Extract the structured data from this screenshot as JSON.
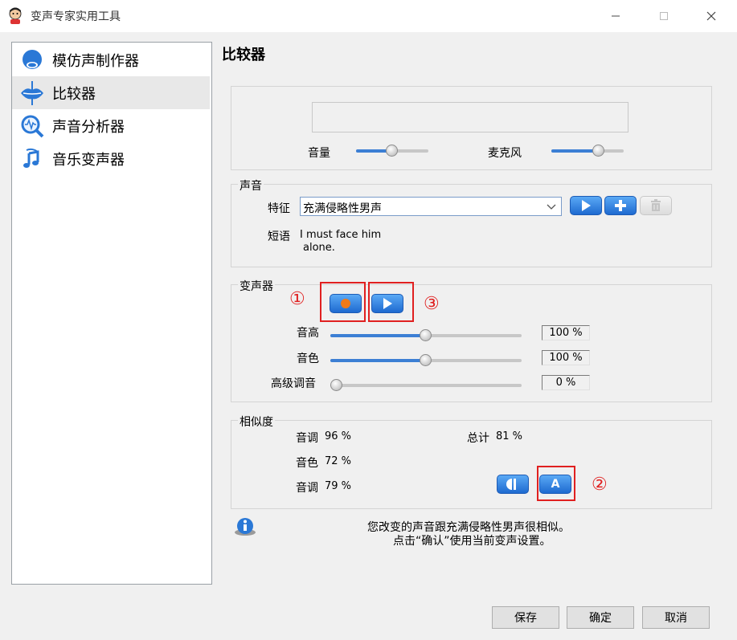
{
  "window": {
    "title": "变声专家实用工具"
  },
  "sidebar": {
    "items": [
      {
        "label": "模仿声制作器",
        "icon": "face-icon",
        "selected": false
      },
      {
        "label": "比较器",
        "icon": "lips-icon",
        "selected": true
      },
      {
        "label": "声音分析器",
        "icon": "magnifier-wave-icon",
        "selected": false
      },
      {
        "label": "音乐变声器",
        "icon": "music-note-icon",
        "selected": false
      }
    ]
  },
  "page": {
    "heading": "比较器"
  },
  "meters": {
    "volume_label": "音量",
    "volume_level": 0.5,
    "mic_label": "麦克风",
    "mic_level": 0.65
  },
  "voice": {
    "group_title": "声音",
    "feature_label": "特征",
    "feature_value": "充满侵略性男声",
    "phrase_label": "短语",
    "phrase_text_line1": "I must face him",
    "phrase_text_line2": "alone."
  },
  "changer": {
    "group_title": "变声器",
    "marker_1": "①",
    "marker_3": "③",
    "pitch_label": "音高",
    "pitch_value": "100 %",
    "pitch_level": 0.5,
    "timbre_label": "音色",
    "timbre_value": "100 %",
    "timbre_level": 0.5,
    "advanced_label": "高级调音",
    "advanced_value": "0 %",
    "advanced_level": 0.0
  },
  "similarity": {
    "group_title": "相似度",
    "row1_label": "音调",
    "row1_value": "96 %",
    "total_label": "总计",
    "total_value": "81 %",
    "row2_label": "音色",
    "row2_value": "72 %",
    "row3_label": "音调",
    "row3_value": "79 %",
    "marker_2": "②",
    "a_button_label": "A"
  },
  "info": {
    "line1": "您改变的声音跟充满侵略性男声很相似。",
    "line2": "点击“确认”使用当前变声设置。"
  },
  "footer": {
    "save_label": "保存",
    "ok_label": "确定",
    "cancel_label": "取消"
  },
  "colors": {
    "accent": "#3c7fd4",
    "annotation_red": "#e02020",
    "record_orange": "#f07a1a"
  }
}
